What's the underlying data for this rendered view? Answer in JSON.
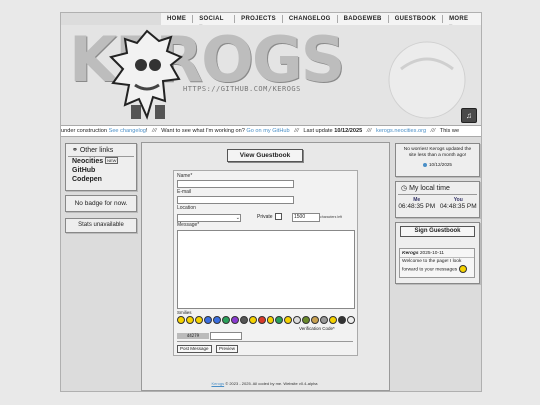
{
  "nav": [
    "HOME",
    "SOCIAL ▾",
    "PROJECTS",
    "CHANGELOG",
    "BADGEWEB",
    "GUESTBOOK",
    "MORE ▾"
  ],
  "header": {
    "logo": "KEROGS",
    "url": "HTTPS://GITHUB.COM/KEROGS",
    "sound_icon": "speaker-icon"
  },
  "ticker": {
    "t1": "under construction",
    "l1": "See changelog",
    "t2": "!",
    "t3": "Want to see what I'm working on?",
    "l2": "Go on my GitHub",
    "t4": "Last update",
    "date": "10/12/2025",
    "l3": "kerogs.neocities.org",
    "t5": "This we",
    "sep": "///"
  },
  "left": {
    "links_title": "Other links",
    "links_icon": "link-icon",
    "links": [
      {
        "label": "Neocities",
        "badge": "NEW"
      },
      {
        "label": "GitHub",
        "badge": ""
      },
      {
        "label": "Codepen",
        "badge": ""
      }
    ],
    "badge_text": "No badge for now.",
    "stats_text": "Stats unavailable"
  },
  "main": {
    "view_btn": "View Guestbook",
    "labels": {
      "name": "Name*",
      "email": "E-mail",
      "location": "Location",
      "private": "Private",
      "message": "Message*",
      "smilies": "Smilies",
      "verify": "Verification Code*",
      "chars_left": "characters left"
    },
    "char_count": "1500",
    "captcha": "d4279",
    "post_btn": "Post Message",
    "preview_btn": "Preview",
    "footer": {
      "link": "Kerogs",
      "text": "© 2023 - 2025. All coded by me. Website v0.4-alpha"
    }
  },
  "right": {
    "notice": "No worries! Kerogs updated the site less than a month ago!",
    "notice_date": "10/12/2025",
    "time_title": "My local time",
    "me_label": "Me",
    "you_label": "You",
    "me_time": "06:48:35 PM",
    "you_time": "04:48:35 PM",
    "sign_btn": "Sign Guestbook",
    "entry_name": "Kerogs",
    "entry_date": "2025-10-11",
    "entry_msg": "Welcome to the page! I look forward to your messages"
  },
  "colors": {
    "link": "#4a8fc7",
    "panel": "#eeeeee",
    "accent": "#333366"
  }
}
